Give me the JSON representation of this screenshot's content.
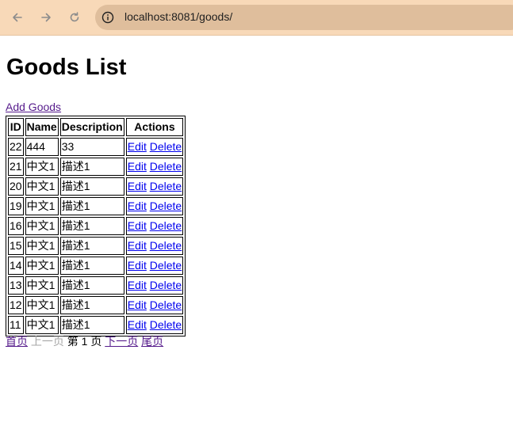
{
  "browser": {
    "url": "localhost:8081/goods/",
    "icons": [
      "back-arrow-icon",
      "forward-arrow-icon",
      "reload-icon",
      "info-icon"
    ]
  },
  "page": {
    "title": "Goods List",
    "add_link": "Add Goods"
  },
  "table": {
    "headers": [
      "ID",
      "Name",
      "Description",
      "Actions"
    ],
    "edit_label": "Edit",
    "delete_label": "Delete",
    "rows": [
      {
        "id": "22",
        "name": "444",
        "description": "33"
      },
      {
        "id": "21",
        "name": "中文1",
        "description": "描述1"
      },
      {
        "id": "20",
        "name": "中文1",
        "description": "描述1"
      },
      {
        "id": "19",
        "name": "中文1",
        "description": "描述1"
      },
      {
        "id": "16",
        "name": "中文1",
        "description": "描述1"
      },
      {
        "id": "15",
        "name": "中文1",
        "description": "描述1"
      },
      {
        "id": "14",
        "name": "中文1",
        "description": "描述1"
      },
      {
        "id": "13",
        "name": "中文1",
        "description": "描述1"
      },
      {
        "id": "12",
        "name": "中文1",
        "description": "描述1"
      },
      {
        "id": "11",
        "name": "中文1",
        "description": "描述1"
      }
    ]
  },
  "pagination": {
    "first": "首页",
    "prev": "上一页",
    "current": "第 1 页",
    "next": "下一页",
    "last": "尾页"
  },
  "colors": {
    "toolbar_bg": "#f8d9b8",
    "address_bg": "#dfbe9c",
    "link_blue": "#0000ee",
    "link_visited": "#551a8b",
    "disabled": "#a6a6a6"
  }
}
